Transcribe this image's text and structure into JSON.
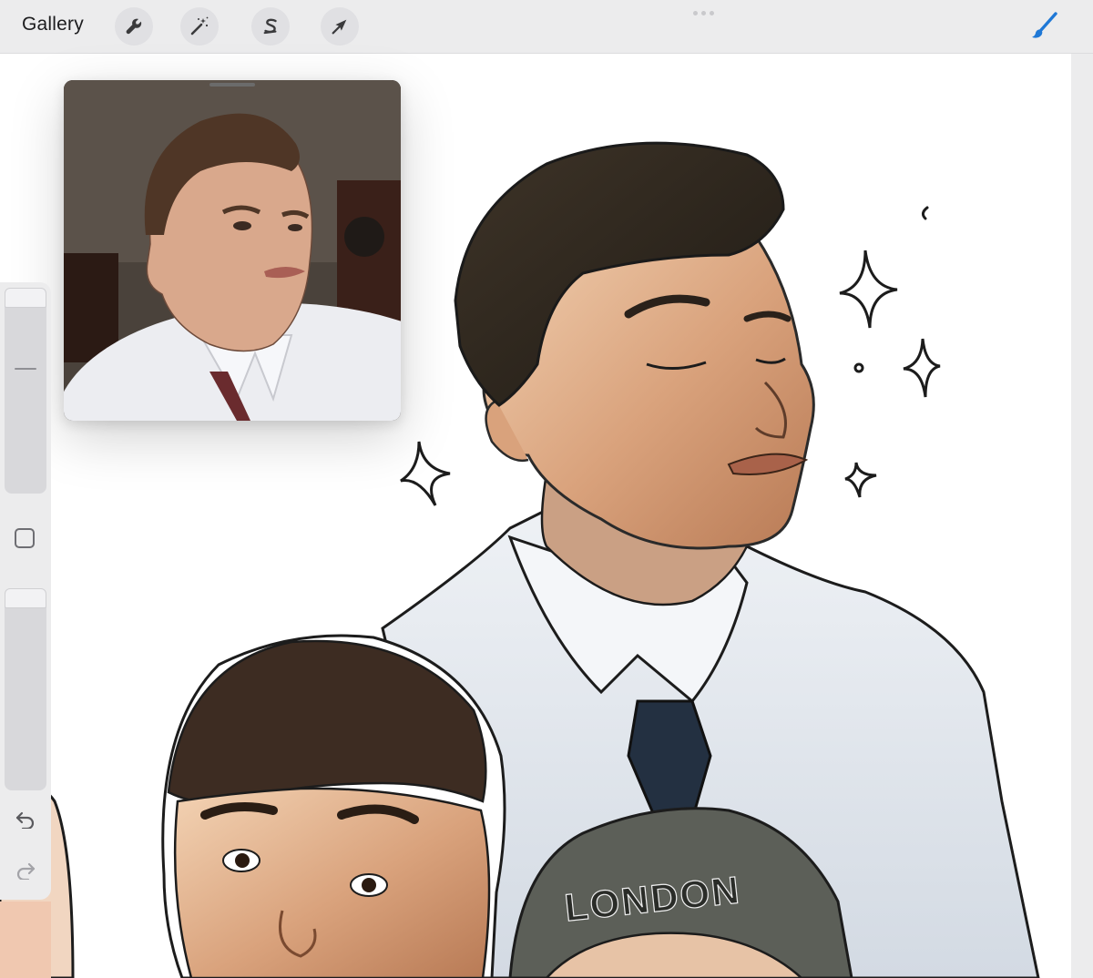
{
  "toolbar": {
    "gallery_label": "Gallery",
    "tools": [
      {
        "name": "actions",
        "icon": "wrench-icon"
      },
      {
        "name": "adjustments",
        "icon": "magic-wand-icon"
      },
      {
        "name": "selection",
        "icon": "selection-s-icon"
      },
      {
        "name": "transform",
        "icon": "arrow-cursor-icon"
      }
    ],
    "active_tool": {
      "name": "brush",
      "icon": "brush-icon",
      "color": "#1f78d6"
    }
  },
  "canvas": {
    "hat_text": "LONDON",
    "background": "#ffffff"
  },
  "reference_window": {
    "content": "photo-reference"
  },
  "sidebar": {
    "size_slider": "brush-size",
    "opacity_slider": "brush-opacity",
    "modify_button": "modify-square-icon",
    "undo_icon": "undo-icon",
    "redo_icon": "redo-icon"
  },
  "colors": {
    "ui_background": "#ececed",
    "accent": "#1f78d6",
    "icon_gray": "#3a3a3c"
  }
}
